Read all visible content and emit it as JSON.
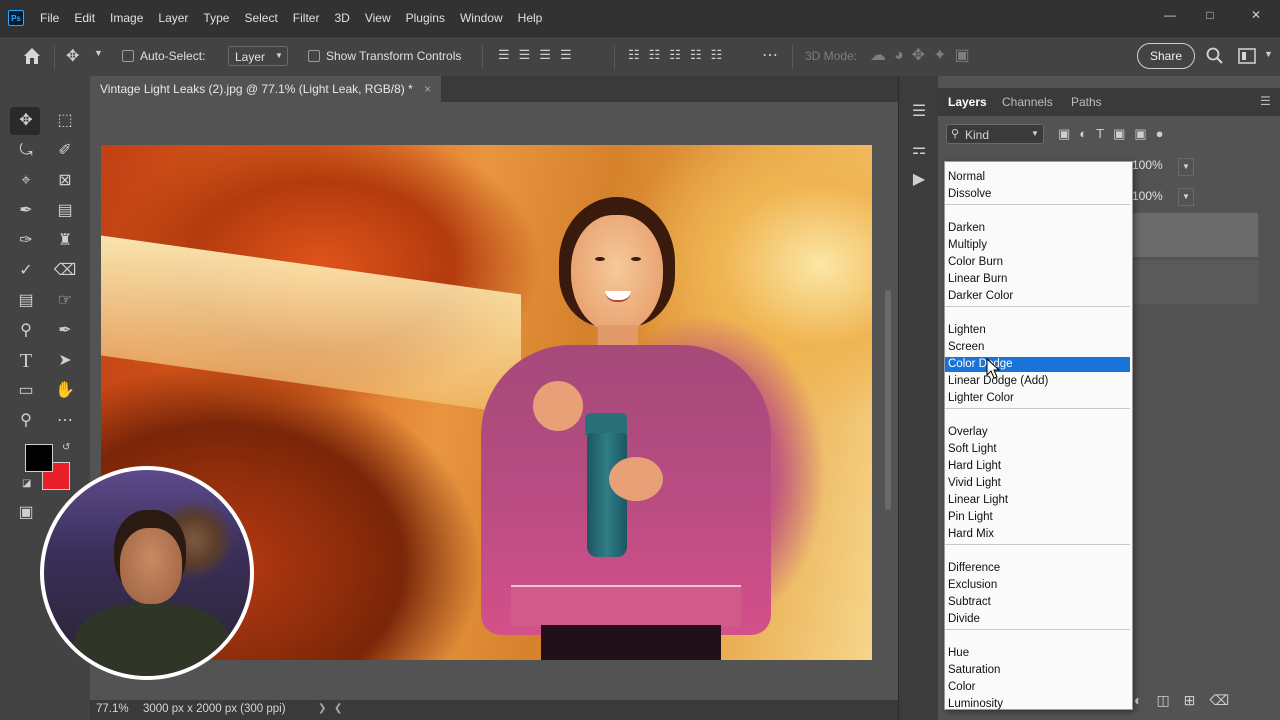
{
  "app": {
    "logo_text": "Ps"
  },
  "menu": [
    "File",
    "Edit",
    "Image",
    "Layer",
    "Type",
    "Select",
    "Filter",
    "3D",
    "View",
    "Plugins",
    "Window",
    "Help"
  ],
  "options": {
    "auto_select_label": "Auto-Select:",
    "layer_select": "Layer",
    "show_transform_label": "Show Transform Controls",
    "mode_3d_label": "3D Mode:",
    "share_label": "Share"
  },
  "document": {
    "tab_title": "Vintage Light Leaks (2).jpg @ 77.1% (Light Leak, RGB/8) *",
    "zoom": "77.1%",
    "dimensions": "3000 px x 2000 px (300 ppi)"
  },
  "layers_panel": {
    "tabs": [
      "Layers",
      "Channels",
      "Paths"
    ],
    "filter_kind": "Kind",
    "opacity_value": "100%",
    "fill_value": "100%"
  },
  "blend_modes": {
    "groups": [
      [
        "Normal",
        "Dissolve"
      ],
      [
        "Darken",
        "Multiply",
        "Color Burn",
        "Linear Burn",
        "Darker Color"
      ],
      [
        "Lighten",
        "Screen",
        "Color Dodge",
        "Linear Dodge (Add)",
        "Lighter Color"
      ],
      [
        "Overlay",
        "Soft Light",
        "Hard Light",
        "Vivid Light",
        "Linear Light",
        "Pin Light",
        "Hard Mix"
      ],
      [
        "Difference",
        "Exclusion",
        "Subtract",
        "Divide"
      ],
      [
        "Hue",
        "Saturation",
        "Color",
        "Luminosity"
      ]
    ],
    "selected": "Color Dodge"
  },
  "colors": {
    "foreground": "#000000",
    "background": "#e8202a",
    "selection": "#1a73d9"
  }
}
